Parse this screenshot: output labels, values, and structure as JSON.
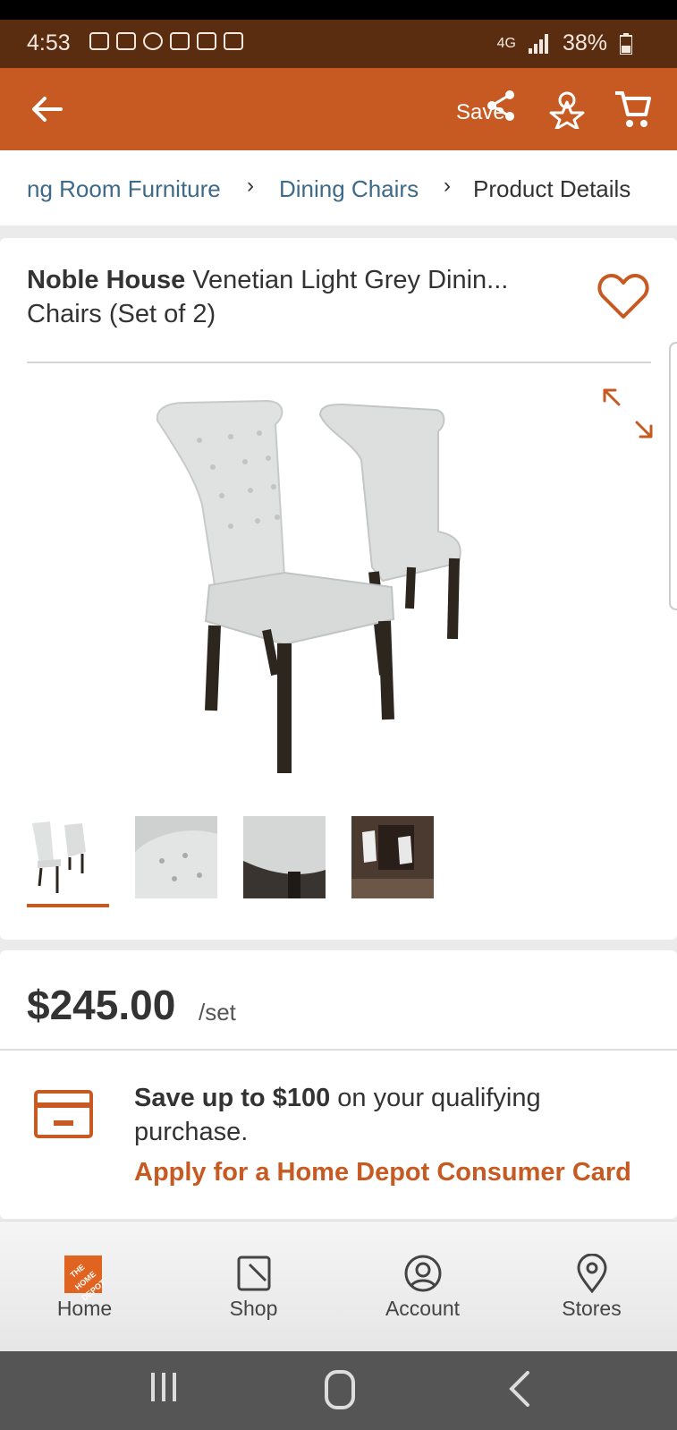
{
  "status_bar": {
    "time": "4:53",
    "signal": "4G",
    "battery": "38%"
  },
  "app_bar": {
    "save_label": "Save"
  },
  "breadcrumb": {
    "items": [
      "ng Room Furniture",
      "Dining Chairs",
      "Product Details"
    ]
  },
  "product": {
    "brand": "Noble House",
    "title_line1": "Venetian Light Grey Dinin...",
    "title_line2": "Chairs (Set of 2)",
    "price": "$245.00",
    "unit": "/set",
    "thumbnail_count": 4,
    "selected_thumbnail": 1
  },
  "promo": {
    "highlight": "Save up to $100",
    "text": " on your qualifying purchase.",
    "link": "Apply for a Home Depot Consumer Card"
  },
  "logo_text": "THE HOME DEPOT",
  "bottom_nav": {
    "items": [
      {
        "label": "Home",
        "icon": "home-depot-logo"
      },
      {
        "label": "Shop",
        "icon": "shop-icon"
      },
      {
        "label": "Account",
        "icon": "account-icon"
      },
      {
        "label": "Stores",
        "icon": "location-pin-icon"
      }
    ]
  },
  "colors": {
    "brand_orange": "#c65a22",
    "link_blue": "#3d6a88"
  }
}
